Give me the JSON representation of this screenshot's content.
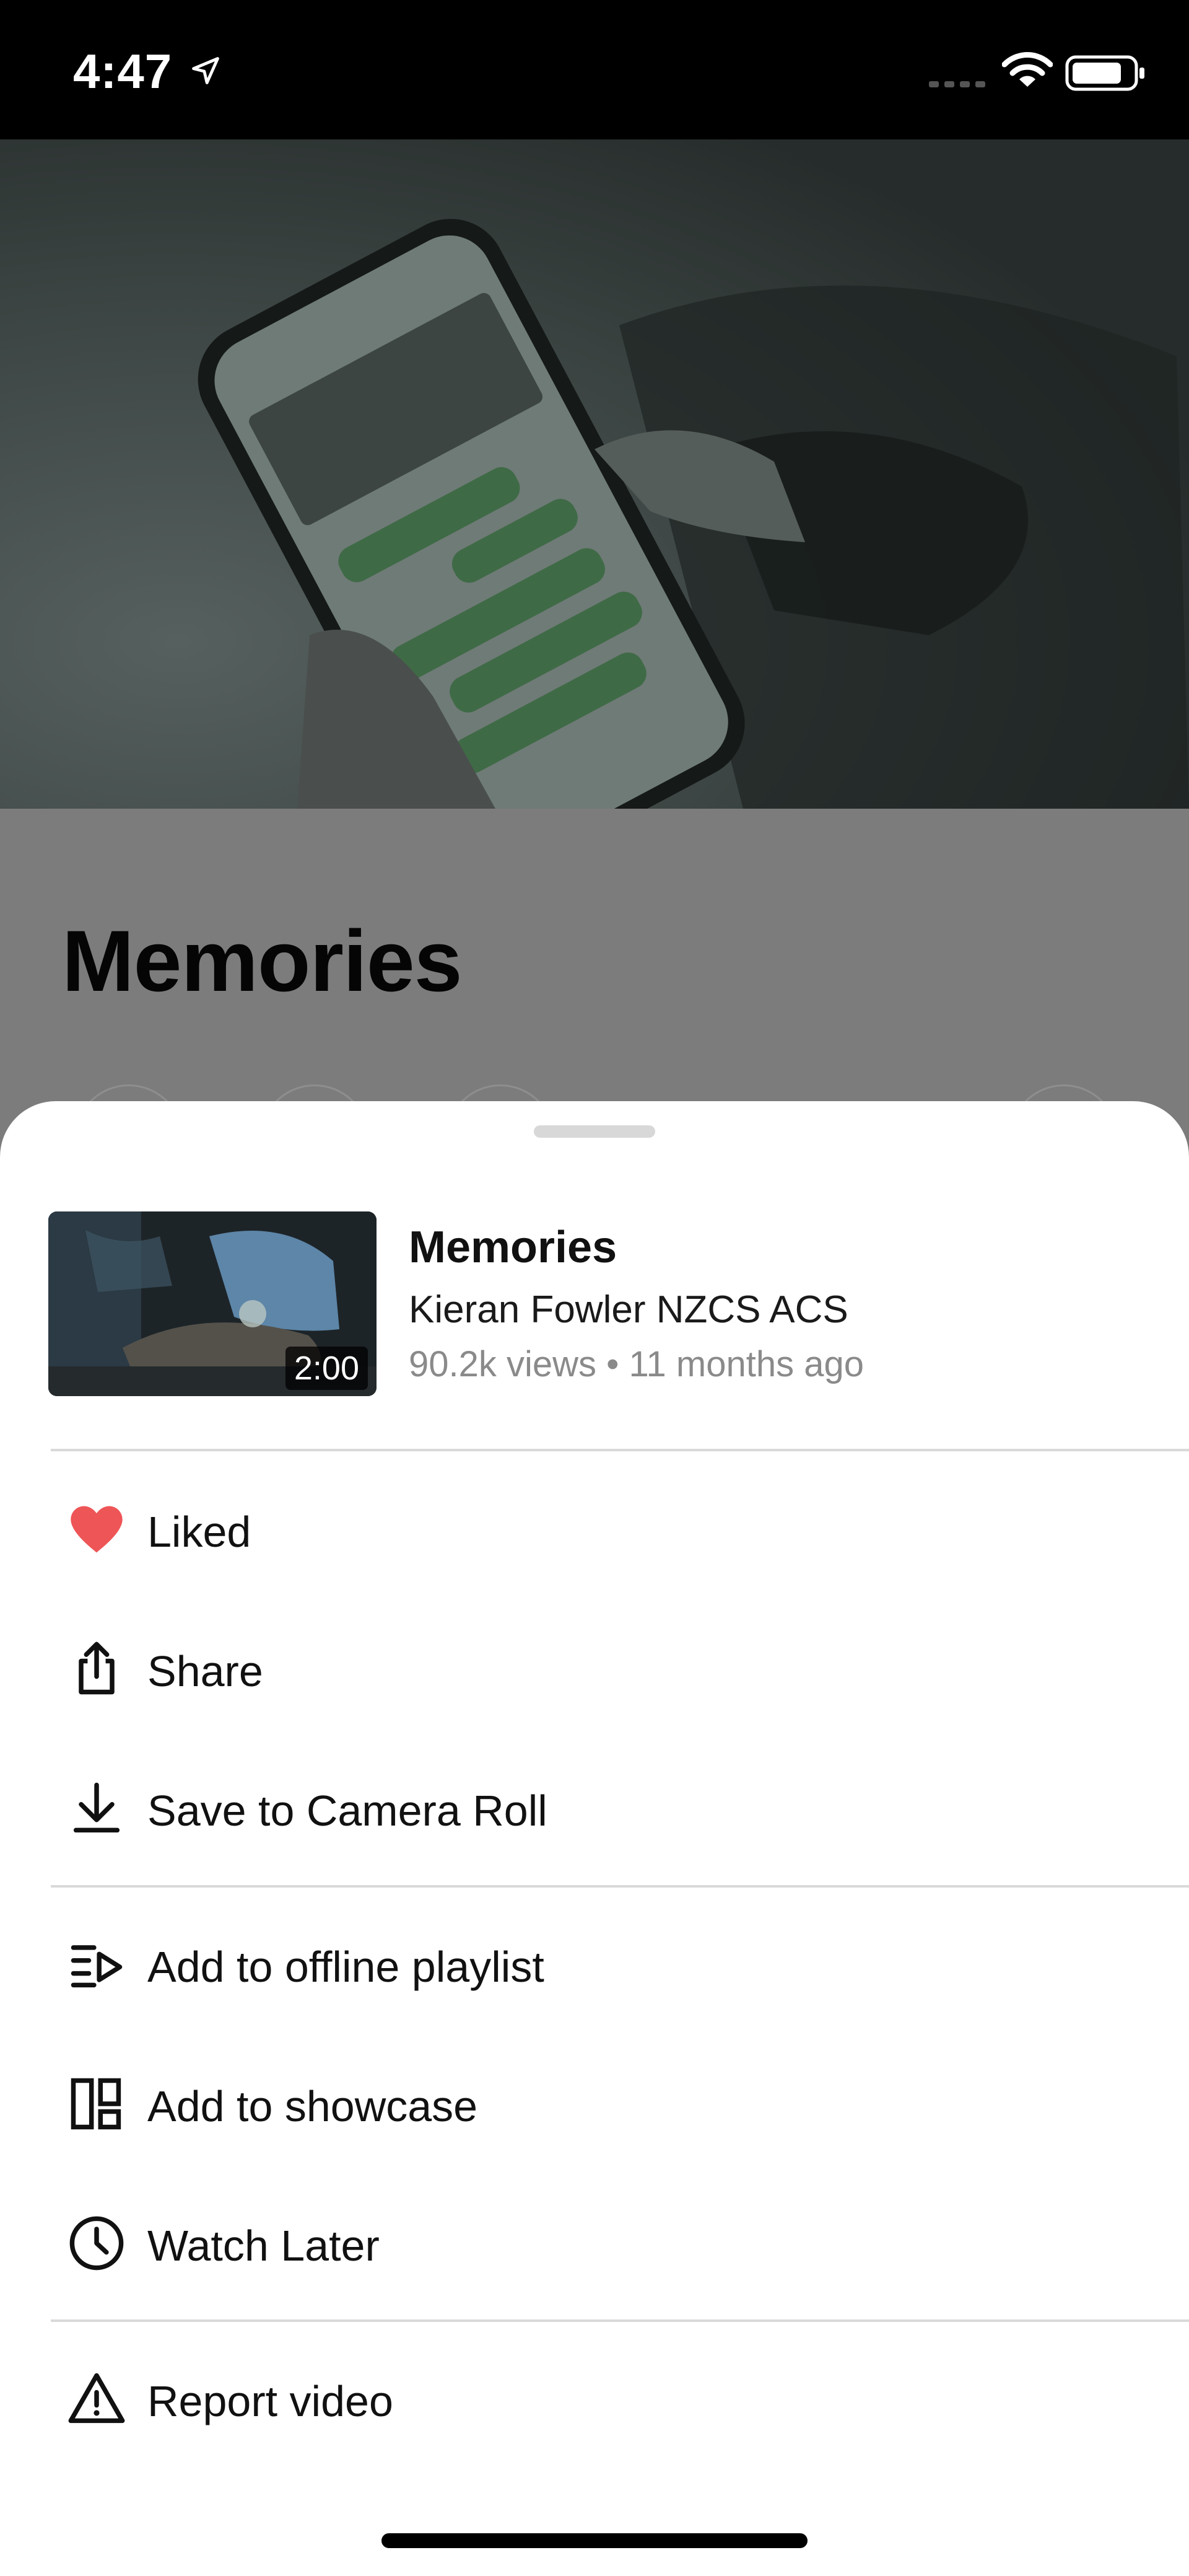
{
  "status_bar": {
    "time": "4:47"
  },
  "page": {
    "title": "Memories"
  },
  "video": {
    "title": "Memories",
    "author": "Kieran Fowler NZCS ACS",
    "meta": "90.2k views • 11 months ago",
    "duration": "2:00"
  },
  "menu": {
    "liked": "Liked",
    "share": "Share",
    "save": "Save to Camera Roll",
    "offline": "Add to offline playlist",
    "showcase": "Add to showcase",
    "watch_later": "Watch Later",
    "report": "Report video"
  },
  "colors": {
    "liked_heart": "#ee5557",
    "sheet_bg": "#ffffff",
    "dim_overlay": "#7c7c7c"
  }
}
